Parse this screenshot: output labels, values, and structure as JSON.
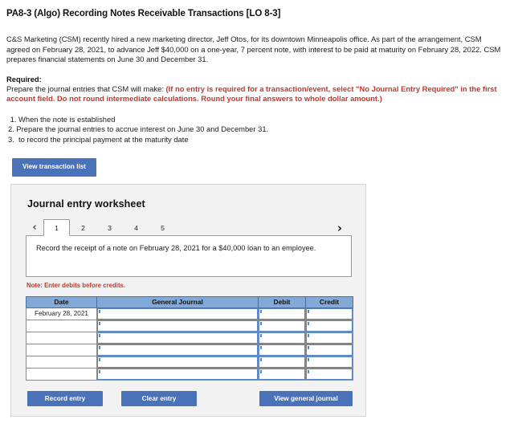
{
  "problem": {
    "title": "PA8-3 (Algo) Recording Notes Receivable Transactions [LO 8-3]",
    "intro": "C&S Marketing (CSM) recently hired a new marketing director, Jeff Otos, for its downtown Minneapolis office. As part of the arrangement, CSM agreed on February 28, 2021, to advance Jeff $40,000 on a one-year, 7 percent note, with interest to be paid at maturity on February 28, 2022. CSM prepares financial statements on June 30 and December 31.",
    "required_label": "Required:",
    "required_lead": "Prepare the journal entries that CSM will make:",
    "required_emphasis": "(If no entry is required for a transaction/event, select \"No Journal Entry Required\" in the first account field. Do not round intermediate calculations. Round your final answers to whole dollar amount.)",
    "steps": [
      " 1. When the note is established",
      "2. Prepare the journal entries to accrue interest on June 30 and December 31.",
      "3.  to record the principal payment at the maturity date"
    ]
  },
  "toolbar": {
    "view_transaction_list_label": "View transaction list"
  },
  "worksheet": {
    "heading": "Journal entry worksheet",
    "prev_arrow": "‹",
    "next_arrow": "›",
    "tabs": [
      {
        "label": "1",
        "active": true
      },
      {
        "label": "2",
        "active": false
      },
      {
        "label": "3",
        "active": false
      },
      {
        "label": "4",
        "active": false
      },
      {
        "label": "5",
        "active": false
      }
    ],
    "description": "Record the receipt of a note on February 28, 2021 for a $40,000 loan to an employee.",
    "note": "Note: Enter debits before credits.",
    "table": {
      "headers": [
        "Date",
        "General Journal",
        "Debit",
        "Credit"
      ],
      "rows": [
        {
          "date": "February 28, 2021",
          "general_journal": "",
          "debit": "",
          "credit": ""
        },
        {
          "date": "",
          "general_journal": "",
          "debit": "",
          "credit": ""
        },
        {
          "date": "",
          "general_journal": "",
          "debit": "",
          "credit": ""
        },
        {
          "date": "",
          "general_journal": "",
          "debit": "",
          "credit": ""
        },
        {
          "date": "",
          "general_journal": "",
          "debit": "",
          "credit": ""
        },
        {
          "date": "",
          "general_journal": "",
          "debit": "",
          "credit": ""
        }
      ]
    },
    "buttons": {
      "record_entry": "Record entry",
      "clear_entry": "Clear entry",
      "view_general_journal": "View general journal"
    }
  },
  "colors": {
    "button_blue": "#4a72b8",
    "table_header_blue": "#83a9d7",
    "alert_red": "#c0392b",
    "panel_gray": "#f2f2f2"
  }
}
